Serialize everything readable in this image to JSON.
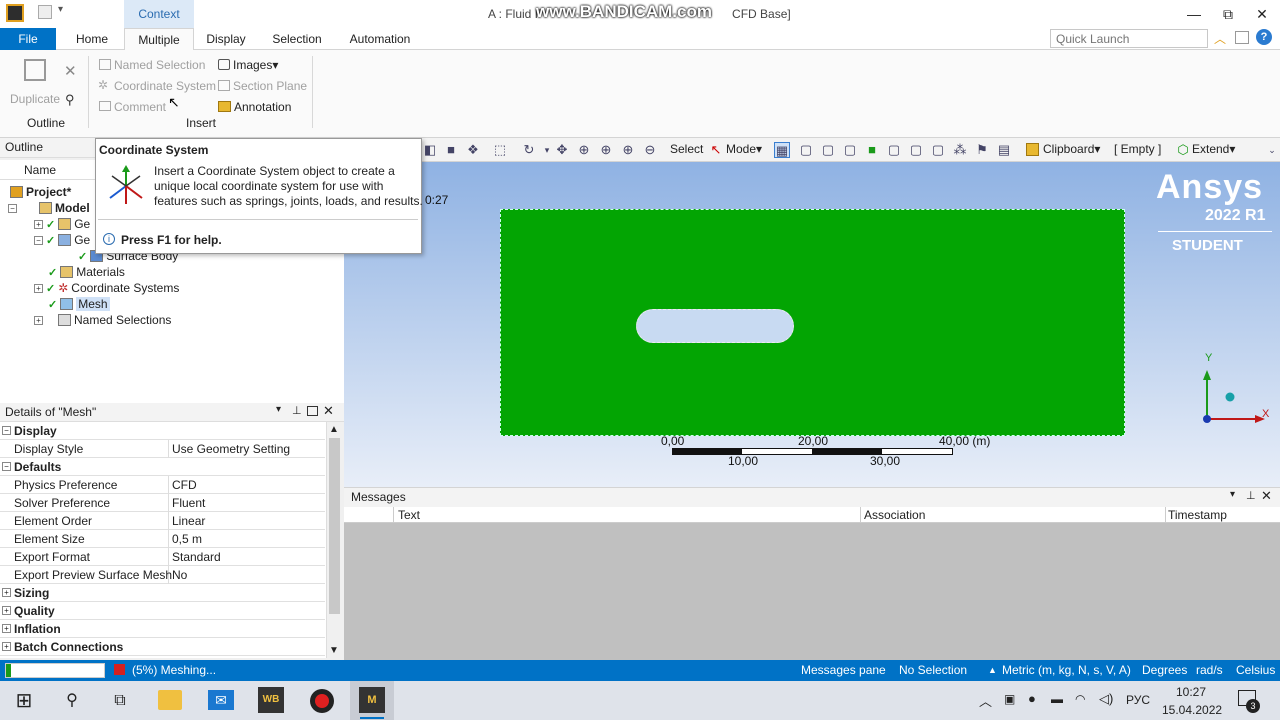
{
  "titlebar": {
    "context_tab": "Context",
    "title_left": "A : Fluid F",
    "watermark": "www.BANDICAM.com",
    "title_right": "CFD Base]",
    "min": "—",
    "max": "⧉",
    "close": "✕"
  },
  "ribbon_tabs": [
    "File",
    "Home",
    "Multiple",
    "Display",
    "Selection",
    "Automation"
  ],
  "quick_launch": {
    "placeholder": "Quick Launch"
  },
  "ribbon": {
    "duplicate": "Duplicate",
    "outline_group": "Outline",
    "named_selection": "Named Selection",
    "coordinate_system": "Coordinate System",
    "comment": "Comment",
    "images": "Images",
    "section_plane": "Section Plane",
    "annotation": "Annotation",
    "insert_group": "Insert"
  },
  "toolbar": {
    "select": "Select",
    "mode": "Mode",
    "clipboard": "Clipboard",
    "empty": "[ Empty ]",
    "extend": "Extend"
  },
  "outline": {
    "title": "Outline",
    "name_col": "Name",
    "project": "Project*",
    "model": "Model",
    "ge1": "Ge",
    "ge2": "Ge",
    "surface_body": "Surface Body",
    "materials": "Materials",
    "coordinate_systems": "Coordinate Systems",
    "mesh": "Mesh",
    "named_selections": "Named Selections"
  },
  "tooltip": {
    "title": "Coordinate System",
    "body1": "Insert a Coordinate System object to create a",
    "body2": "unique local coordinate system for use with",
    "body3": "features such as springs, joints, loads, and results.",
    "help": "Press F1 for help.",
    "time_frag": "0:27"
  },
  "details": {
    "title": "Details of \"Mesh\"",
    "rows": [
      {
        "k": "Display",
        "v": "",
        "cat": true
      },
      {
        "k": "Display Style",
        "v": "Use Geometry Setting"
      },
      {
        "k": "Defaults",
        "v": "",
        "cat": true
      },
      {
        "k": "Physics Preference",
        "v": "CFD"
      },
      {
        "k": "Solver Preference",
        "v": "Fluent"
      },
      {
        "k": "Element Order",
        "v": "Linear"
      },
      {
        "k": "Element Size",
        "v": "0,5 m"
      },
      {
        "k": "Export Format",
        "v": "Standard"
      },
      {
        "k": "Export Preview Surface Mesh",
        "v": "No"
      },
      {
        "k": "Sizing",
        "v": "",
        "cat": true
      },
      {
        "k": "Quality",
        "v": "",
        "cat": true
      },
      {
        "k": "Inflation",
        "v": "",
        "cat": true
      },
      {
        "k": "Batch Connections",
        "v": "",
        "cat": true
      }
    ]
  },
  "viewport": {
    "logo": "Ansys",
    "version": "2022 R1",
    "edition": "STUDENT",
    "scale_top": [
      "0,00",
      "20,00",
      "40,00 (m)"
    ],
    "scale_bottom": [
      "10,00",
      "30,00"
    ],
    "axis_y": "Y",
    "axis_x": "X",
    "colors": {
      "geometry": "#03a503",
      "accent": "#0072c6"
    }
  },
  "messages": {
    "title": "Messages",
    "cols": [
      "Text",
      "Association",
      "Timestamp"
    ]
  },
  "status": {
    "progress": "(5%) Meshing...",
    "progress_fraction": 0.05,
    "messages_pane": "Messages pane",
    "selection": "No Selection",
    "units": "Metric (m, kg, N, s, V, A)",
    "degrees": "Degrees",
    "rads": "rad/s",
    "celsius": "Celsius"
  },
  "taskbar": {
    "lang": "РУС",
    "time": "10:27",
    "date": "15.04.2022",
    "wb_label": "WB",
    "m_label": "M",
    "notif": "3"
  }
}
